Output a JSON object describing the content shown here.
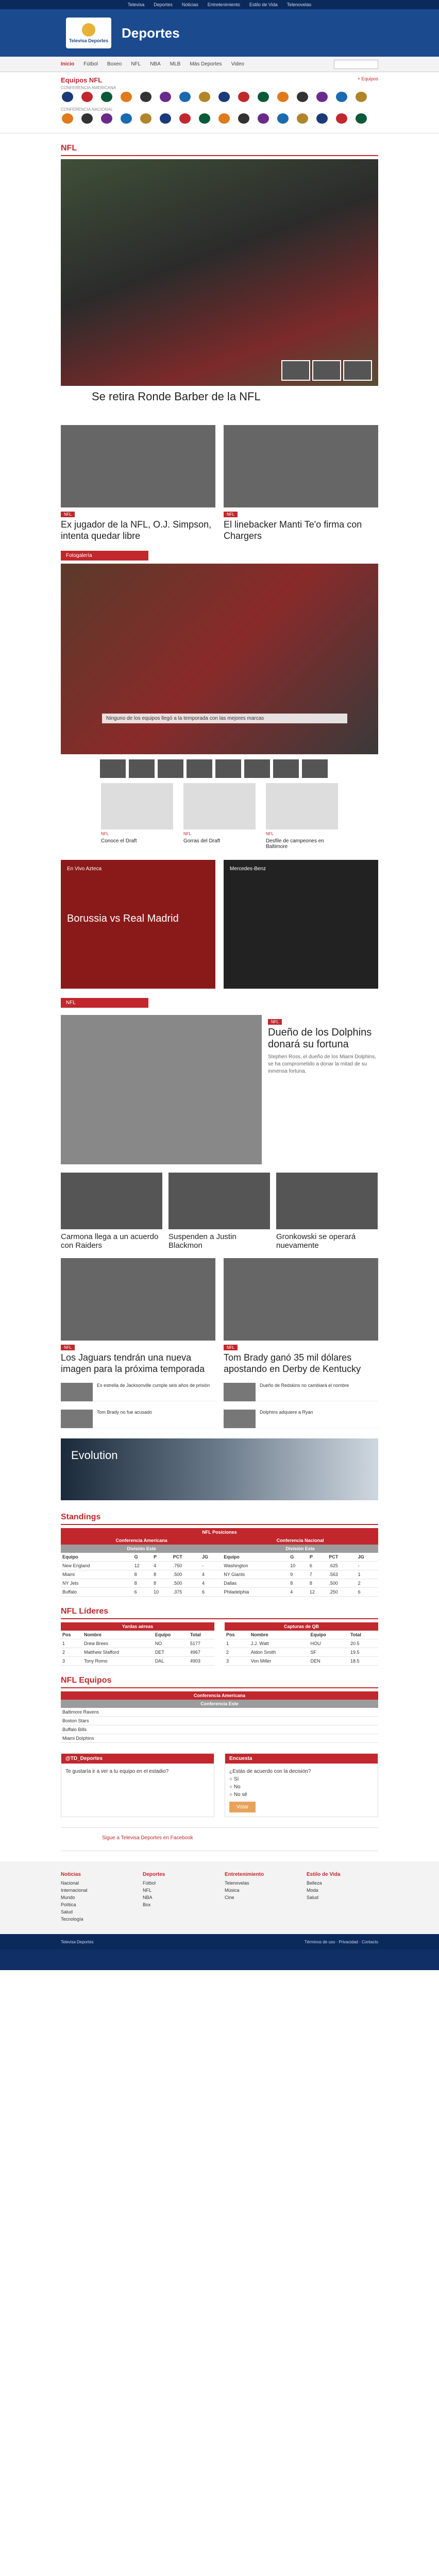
{
  "topbar": {
    "links": [
      "Televisa",
      "Deportes",
      "Noticias",
      "Entretenimiento",
      "Estilo de Vida",
      "Telenovelas"
    ]
  },
  "header": {
    "logo": "Televisa Deportes",
    "section": "Deportes"
  },
  "nav": {
    "home": "Inicio",
    "items": [
      "Fútbol",
      "Boxeo",
      "NFL",
      "NBA",
      "MLB",
      "Más Deportes",
      "Video"
    ]
  },
  "teams": {
    "title": "Equipos NFL",
    "link": "+ Equipos",
    "conf1": "CONFERENCIA AMERICANA",
    "conf2": "CONFERENCIA NACIONAL"
  },
  "sections": {
    "nfl": "NFL",
    "photogallery": "Fotogalería",
    "standings": "Standings",
    "leaders": "NFL Líderes",
    "teams": "NFL Equipos"
  },
  "hero": {
    "title": "Se retira Ronde Barber de la NFL"
  },
  "news1": [
    {
      "tag": "NFL",
      "title": "Ex jugador de la NFL, O.J. Simpson, intenta quedar libre"
    },
    {
      "tag": "NFL",
      "title": "El linebacker Manti Te'o firma con Chargers"
    }
  ],
  "gallery": {
    "caption": "Ninguno de los equipos llegó a la temporada con las mejores marcas"
  },
  "products": [
    {
      "tag": "NFL",
      "name": "Conoce el Draft"
    },
    {
      "tag": "NFL",
      "name": "Gorras del Draft"
    },
    {
      "tag": "NFL",
      "name": "Desfile de campeones en Baltimore"
    }
  ],
  "ads": {
    "a1": "En Vivo Azteca",
    "a2": "Mercedes-Benz",
    "a1text": "Borussia vs Real Madrid"
  },
  "feature": {
    "tag": "NFL",
    "title": "Dueño de los Dolphins donará su fortuna",
    "body": "Stephen Ross, el dueño de los Miami Dolphins, se ha comprometido a donar la mitad de su inmensa fortuna."
  },
  "row3": [
    {
      "title": "Carmona llega a un acuerdo con Raiders"
    },
    {
      "title": "Suspenden a Justin Blackmon"
    },
    {
      "title": "Gronkowski se operará nuevamente"
    }
  ],
  "news2": [
    {
      "tag": "NFL",
      "title": "Los Jaguars tendrán una nueva imagen para la próxima temporada"
    },
    {
      "tag": "NFL",
      "title": "Tom Brady ganó 35 mil dólares apostando en Derby de Kentucky"
    }
  ],
  "mini": [
    "Es estrella de Jacksonville cumple seis años de prisión",
    "Dueño de Redskins no cambiará el nombre",
    "Tom Brady no fue acusado",
    "Dolphins adquiere a Ryan"
  ],
  "bigad": {
    "text": "Evolution"
  },
  "standings": {
    "title": "NFL Posiciones",
    "conf_a": "Conferencia Americana",
    "conf_n": "Conferencia Nacional",
    "div": "División Este",
    "cols": [
      "Equipo",
      "G",
      "P",
      "PCT",
      "JG"
    ],
    "rows_a": [
      [
        "New England",
        12,
        4,
        ".750",
        "-"
      ],
      [
        "Miami",
        8,
        8,
        ".500",
        "4"
      ],
      [
        "NY Jets",
        8,
        8,
        ".500",
        "4"
      ],
      [
        "Buffalo",
        6,
        10,
        ".375",
        "6"
      ]
    ],
    "rows_n": [
      [
        "Washington",
        10,
        6,
        ".625",
        "-"
      ],
      [
        "NY Giants",
        9,
        7,
        ".563",
        "1"
      ],
      [
        "Dallas",
        8,
        8,
        ".500",
        "2"
      ],
      [
        "Philadelphia",
        4,
        12,
        ".250",
        "6"
      ]
    ]
  },
  "leaders": {
    "t1": "Yardas aéreas",
    "t2": "Capturas de QB",
    "cols": [
      "Pos",
      "Nombre",
      "Equipo",
      "Total"
    ],
    "l1": [
      [
        "1",
        "Drew Brees",
        "NO",
        "5177"
      ],
      [
        "2",
        "Matthew Stafford",
        "DET",
        "4967"
      ],
      [
        "3",
        "Tony Romo",
        "DAL",
        "4903"
      ]
    ],
    "l2": [
      [
        "1",
        "J.J. Watt",
        "HOU",
        "20.5"
      ],
      [
        "2",
        "Aldon Smith",
        "SF",
        "19.5"
      ],
      [
        "3",
        "Von Miller",
        "DEN",
        "18.5"
      ]
    ]
  },
  "teamsTbl": {
    "title": "Conferencia Americana",
    "div": "Conferencia Este",
    "teams": [
      "Baltimore Ravens",
      "Boston Stars",
      "Buffalo Bills",
      "Miami Dolphins"
    ]
  },
  "poll": {
    "twitter": "@TD_Deportes",
    "tweet": "Te gustaría ir a ver a tu equipo en el estadio?",
    "encuesta": "Encuesta",
    "q": "¿Estás de acuerdo con la decisión?",
    "opts": [
      "Sí",
      "No",
      "No sé"
    ],
    "vote": "Votar"
  },
  "fb": {
    "text": "Sigue a Televisa Deportes en Facebook"
  },
  "footer": {
    "c1": "Noticias",
    "c1i": [
      "Nacional",
      "Internacional",
      "Mundo",
      "Política",
      "Salud",
      "Tecnología"
    ],
    "c2": "Deportes",
    "c2i": [
      "Fútbol",
      "NFL",
      "NBA",
      "Box"
    ],
    "c3": "Entretenimiento",
    "c3i": [
      "Telenovelas",
      "Música",
      "Cine"
    ],
    "c4": "Estilo de Vida",
    "c4i": [
      "Belleza",
      "Moda",
      "Salud"
    ]
  },
  "footbar": {
    "left": "Televisa Deportes",
    "right": "Términos de uso · Privacidad · Contacto"
  }
}
